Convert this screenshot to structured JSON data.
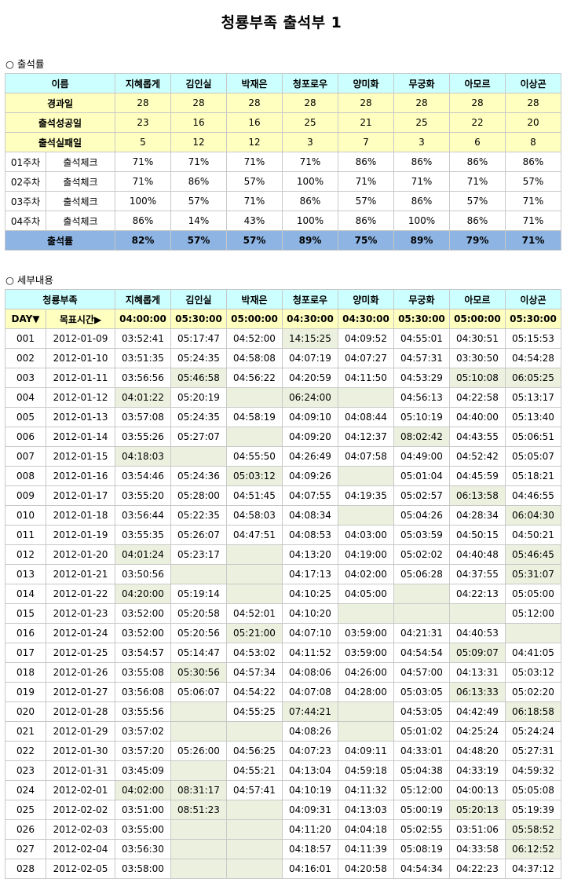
{
  "title": "청룡부족 출석부 1",
  "summary_heading": "○ 출석률",
  "detail_heading": "○ 세부내용",
  "names": [
    "지혜롭게",
    "김인실",
    "박재은",
    "청포로우",
    "양미화",
    "무궁화",
    "아모르",
    "이상곤"
  ],
  "stats": {
    "name_label": "이름",
    "rows": [
      {
        "label": "경과일",
        "values": [
          "28",
          "28",
          "28",
          "28",
          "28",
          "28",
          "28",
          "28"
        ]
      },
      {
        "label": "출석성공일",
        "values": [
          "23",
          "16",
          "16",
          "25",
          "21",
          "25",
          "22",
          "20"
        ]
      },
      {
        "label": "출석실패일",
        "values": [
          "5",
          "12",
          "12",
          "3",
          "7",
          "3",
          "6",
          "8"
        ]
      }
    ],
    "weeks": [
      {
        "week": "01주차",
        "label": "출석체크",
        "values": [
          "71%",
          "71%",
          "71%",
          "71%",
          "86%",
          "86%",
          "86%",
          "86%"
        ]
      },
      {
        "week": "02주차",
        "label": "출석체크",
        "values": [
          "71%",
          "86%",
          "57%",
          "100%",
          "71%",
          "71%",
          "71%",
          "57%"
        ]
      },
      {
        "week": "03주차",
        "label": "출석체크",
        "values": [
          "100%",
          "57%",
          "71%",
          "86%",
          "57%",
          "86%",
          "57%",
          "71%"
        ]
      },
      {
        "week": "04주차",
        "label": "출석체크",
        "values": [
          "86%",
          "14%",
          "43%",
          "100%",
          "86%",
          "100%",
          "86%",
          "71%"
        ]
      }
    ],
    "rate_label": "출석률",
    "rates": [
      "82%",
      "57%",
      "57%",
      "89%",
      "75%",
      "89%",
      "79%",
      "71%"
    ]
  },
  "detail": {
    "group_label": "청룡부족",
    "day_label": "DAY▼",
    "target_label": "목표시간▶",
    "targets": [
      "04:00:00",
      "05:30:00",
      "05:00:00",
      "04:30:00",
      "04:30:00",
      "05:30:00",
      "05:00:00",
      "05:30:00"
    ],
    "rows": [
      {
        "day": "001",
        "date": "2012-01-09",
        "times": [
          "03:52:41",
          "05:17:47",
          "04:52:00",
          "14:15:25",
          "04:09:52",
          "04:55:01",
          "04:30:51",
          "05:15:53"
        ],
        "hl": [
          3
        ]
      },
      {
        "day": "002",
        "date": "2012-01-10",
        "times": [
          "03:51:35",
          "05:24:35",
          "04:58:08",
          "04:07:19",
          "04:07:27",
          "04:57:31",
          "03:30:50",
          "04:54:28"
        ],
        "hl": []
      },
      {
        "day": "003",
        "date": "2012-01-11",
        "times": [
          "03:56:56",
          "05:46:58",
          "04:56:22",
          "04:20:59",
          "04:11:50",
          "04:53:29",
          "05:10:08",
          "06:05:25"
        ],
        "hl": [
          1,
          6,
          7
        ]
      },
      {
        "day": "004",
        "date": "2012-01-12",
        "times": [
          "04:01:22",
          "05:20:19",
          "",
          "06:24:00",
          "",
          "04:56:13",
          "04:22:58",
          "05:13:17"
        ],
        "hl": [
          0,
          2,
          3,
          4
        ]
      },
      {
        "day": "005",
        "date": "2012-01-13",
        "times": [
          "03:57:08",
          "05:24:35",
          "04:58:19",
          "04:09:10",
          "04:08:44",
          "05:10:19",
          "04:40:00",
          "05:13:40"
        ],
        "hl": []
      },
      {
        "day": "006",
        "date": "2012-01-14",
        "times": [
          "03:55:26",
          "05:27:07",
          "",
          "04:09:20",
          "04:12:37",
          "08:02:42",
          "04:43:55",
          "05:06:51"
        ],
        "hl": [
          2,
          5
        ]
      },
      {
        "day": "007",
        "date": "2012-01-15",
        "times": [
          "04:18:03",
          "",
          "04:55:50",
          "04:26:49",
          "04:07:58",
          "04:49:00",
          "04:52:42",
          "05:05:07"
        ],
        "hl": [
          0,
          1
        ]
      },
      {
        "day": "008",
        "date": "2012-01-16",
        "times": [
          "03:54:46",
          "05:24:36",
          "05:03:12",
          "04:09:26",
          "",
          "05:01:04",
          "04:45:59",
          "05:18:21"
        ],
        "hl": [
          2,
          4
        ]
      },
      {
        "day": "009",
        "date": "2012-01-17",
        "times": [
          "03:55:20",
          "05:28:00",
          "04:51:45",
          "04:07:55",
          "04:19:35",
          "05:02:57",
          "06:13:58",
          "04:46:55"
        ],
        "hl": [
          6
        ]
      },
      {
        "day": "010",
        "date": "2012-01-18",
        "times": [
          "03:56:44",
          "05:22:35",
          "04:58:03",
          "04:08:34",
          "",
          "05:04:26",
          "04:28:34",
          "06:04:30"
        ],
        "hl": [
          4,
          7
        ]
      },
      {
        "day": "011",
        "date": "2012-01-19",
        "times": [
          "03:55:35",
          "05:26:07",
          "04:47:51",
          "04:08:53",
          "04:03:00",
          "05:03:59",
          "04:50:15",
          "04:50:21"
        ],
        "hl": []
      },
      {
        "day": "012",
        "date": "2012-01-20",
        "times": [
          "04:01:24",
          "05:23:17",
          "",
          "04:13:20",
          "04:19:00",
          "05:02:02",
          "04:40:48",
          "05:46:45"
        ],
        "hl": [
          0,
          2,
          7
        ]
      },
      {
        "day": "013",
        "date": "2012-01-21",
        "times": [
          "03:50:56",
          "",
          "",
          "04:17:13",
          "04:02:00",
          "05:06:28",
          "04:37:55",
          "05:31:07"
        ],
        "hl": [
          1,
          2,
          7
        ]
      },
      {
        "day": "014",
        "date": "2012-01-22",
        "times": [
          "04:20:00",
          "05:19:14",
          "",
          "04:10:25",
          "04:05:00",
          "",
          "04:22:13",
          "05:05:00"
        ],
        "hl": [
          0,
          2,
          5
        ]
      },
      {
        "day": "015",
        "date": "2012-01-23",
        "times": [
          "03:52:00",
          "05:20:58",
          "04:52:01",
          "04:10:20",
          "",
          "",
          "",
          "05:12:00"
        ],
        "hl": [
          4,
          5,
          6
        ]
      },
      {
        "day": "016",
        "date": "2012-01-24",
        "times": [
          "03:52:00",
          "05:20:56",
          "05:21:00",
          "04:07:10",
          "03:59:00",
          "04:21:31",
          "04:40:53",
          ""
        ],
        "hl": [
          2,
          7
        ]
      },
      {
        "day": "017",
        "date": "2012-01-25",
        "times": [
          "03:54:57",
          "05:14:47",
          "04:53:02",
          "04:11:52",
          "03:59:00",
          "04:54:54",
          "05:09:07",
          "04:41:05"
        ],
        "hl": [
          6
        ]
      },
      {
        "day": "018",
        "date": "2012-01-26",
        "times": [
          "03:55:08",
          "05:30:56",
          "04:57:34",
          "04:08:06",
          "04:26:00",
          "04:57:00",
          "04:13:31",
          "05:03:12"
        ],
        "hl": [
          1
        ]
      },
      {
        "day": "019",
        "date": "2012-01-27",
        "times": [
          "03:56:08",
          "05:06:07",
          "04:54:22",
          "04:07:08",
          "04:28:00",
          "05:03:05",
          "06:13:33",
          "05:02:20"
        ],
        "hl": [
          6
        ]
      },
      {
        "day": "020",
        "date": "2012-01-28",
        "times": [
          "03:55:56",
          "",
          "04:55:25",
          "07:44:21",
          "",
          "04:53:05",
          "04:42:49",
          "06:18:58"
        ],
        "hl": [
          1,
          3,
          4,
          7
        ]
      },
      {
        "day": "021",
        "date": "2012-01-29",
        "times": [
          "03:57:02",
          "",
          "",
          "04:08:26",
          "",
          "05:01:02",
          "04:25:24",
          "05:24:24"
        ],
        "hl": [
          1,
          2,
          4
        ]
      },
      {
        "day": "022",
        "date": "2012-01-30",
        "times": [
          "03:57:20",
          "05:26:00",
          "04:56:25",
          "04:07:23",
          "04:09:11",
          "04:33:01",
          "04:48:20",
          "05:27:31"
        ],
        "hl": []
      },
      {
        "day": "023",
        "date": "2012-01-31",
        "times": [
          "03:45:09",
          "",
          "04:55:21",
          "04:13:04",
          "04:59:18",
          "05:04:38",
          "04:33:19",
          "04:59:32"
        ],
        "hl": [
          1
        ]
      },
      {
        "day": "024",
        "date": "2012-02-01",
        "times": [
          "04:02:00",
          "08:31:17",
          "04:57:41",
          "04:10:19",
          "04:11:32",
          "05:12:00",
          "04:00:13",
          "05:05:08"
        ],
        "hl": [
          0,
          1
        ]
      },
      {
        "day": "025",
        "date": "2012-02-02",
        "times": [
          "03:51:00",
          "08:51:23",
          "",
          "04:09:31",
          "04:13:03",
          "05:00:19",
          "05:20:13",
          "05:19:39"
        ],
        "hl": [
          1,
          2,
          6
        ]
      },
      {
        "day": "026",
        "date": "2012-02-03",
        "times": [
          "03:55:00",
          "",
          "",
          "04:11:20",
          "04:04:18",
          "05:02:55",
          "03:51:06",
          "05:58:52"
        ],
        "hl": [
          1,
          2,
          7
        ]
      },
      {
        "day": "027",
        "date": "2012-02-04",
        "times": [
          "03:56:30",
          "",
          "",
          "04:18:57",
          "04:11:39",
          "05:08:19",
          "04:33:58",
          "06:12:52"
        ],
        "hl": [
          1,
          2,
          7
        ]
      },
      {
        "day": "028",
        "date": "2012-02-05",
        "times": [
          "03:58:00",
          "",
          "",
          "04:16:01",
          "04:20:58",
          "04:54:34",
          "04:22:23",
          "04:37:12"
        ],
        "hl": [
          1,
          2
        ]
      }
    ]
  }
}
